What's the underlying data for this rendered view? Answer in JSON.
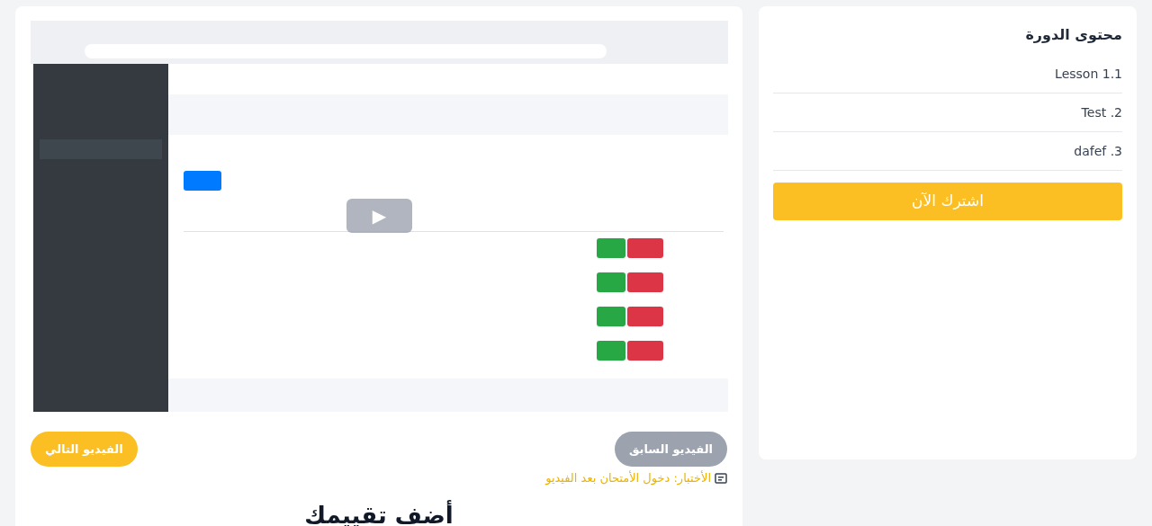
{
  "video": {
    "kind": "picture",
    "play_label": "▶"
  },
  "nav_buttons": [
    {
      "label": "الفيديو السابق",
      "kind": "previous"
    },
    {
      "label": "الفيديو التالي",
      "kind": "next"
    }
  ],
  "quiz_note": "الأختبار: دخول الأمتحان بعد الفيديو",
  "rating_heading": "أضف تقييمك",
  "course_content": {
    "title": "محتوى الدورة",
    "lessons": [
      "Lesson 1.1",
      "Test .2",
      "dafef .3"
    ],
    "subscribe_button": "اشترك الآن"
  }
}
